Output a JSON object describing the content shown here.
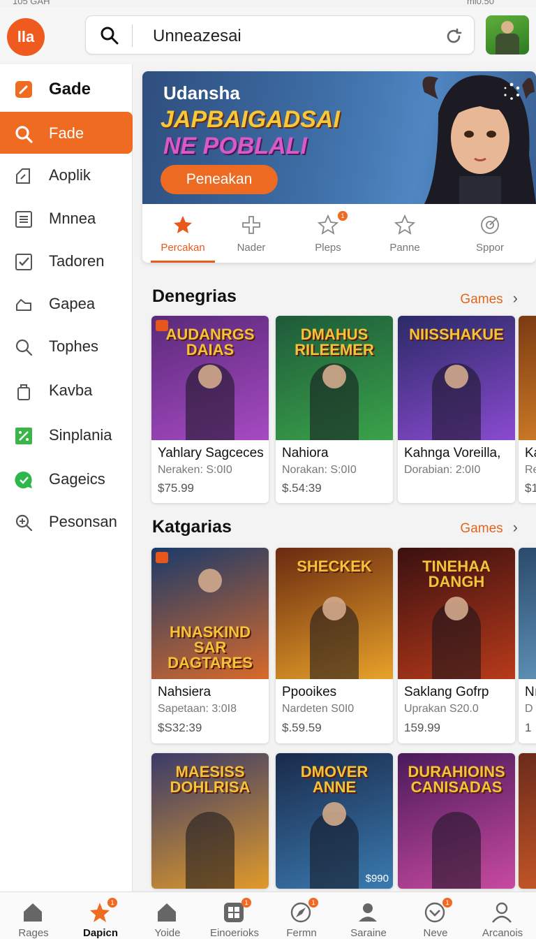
{
  "status_bar": {
    "left_text": "105 GAH",
    "right_text": "mi0.50"
  },
  "header": {
    "logo_text": "lla",
    "search_value": "Unneazesai"
  },
  "sidebar": {
    "items": [
      {
        "label": "Gade",
        "icon": "edit-square-icon"
      },
      {
        "label": "Fade",
        "icon": "search-icon"
      },
      {
        "label": "Aoplik",
        "icon": "tag-icon"
      },
      {
        "label": "Mnnea",
        "icon": "list-icon"
      },
      {
        "label": "Tadoren",
        "icon": "checkbox-icon"
      },
      {
        "label": "Gapea",
        "icon": "cloud-icon"
      },
      {
        "label": "Tophes",
        "icon": "search-icon"
      },
      {
        "label": "Kavba",
        "icon": "bag-icon"
      },
      {
        "label": "Sinplania",
        "icon": "percent-icon"
      },
      {
        "label": "Gageics",
        "icon": "chat-bubble-icon"
      },
      {
        "label": "Pesonsan",
        "icon": "zoom-in-icon"
      }
    ]
  },
  "banner": {
    "subtitle": "Udansha",
    "title_line1": "JAPBAIGADSAI",
    "title_line2": "NE POBLALI",
    "cta_label": "Peneakan"
  },
  "tabs": [
    {
      "label": "Percakan",
      "icon": "star-icon",
      "badge": ""
    },
    {
      "label": "Nader",
      "icon": "plus-icon",
      "badge": ""
    },
    {
      "label": "Pleps",
      "icon": "star-outline-icon",
      "badge": "1"
    },
    {
      "label": "Panne",
      "icon": "star-outline-icon",
      "badge": ""
    },
    {
      "label": "Sppor",
      "icon": "target-icon",
      "badge": ""
    }
  ],
  "section1": {
    "title": "Denegrias",
    "link": "Games",
    "cards": [
      {
        "art_title": "AUDANRGS DAIAS",
        "name": "Yahlary Sagceces",
        "meta": "Neraken: S:0I0",
        "price": "$75.99",
        "colors": [
          "#5a2a7a",
          "#a64ac2"
        ]
      },
      {
        "art_title": "DMAHUS RILEEMER",
        "name": "Nahiora",
        "meta": "Norakan: S:0I0",
        "price": "$.54:39",
        "colors": [
          "#1e5a3a",
          "#3aa34a"
        ]
      },
      {
        "art_title": "NIISSHAKUE",
        "name": "Kahnga Voreilla,",
        "meta": "Dorabian: 2:0I0",
        "price": "",
        "colors": [
          "#2a2a66",
          "#8a4ad0"
        ]
      },
      {
        "art_title": "",
        "name": "Ka",
        "meta": "Re",
        "price": "$1",
        "colors": [
          "#7a3a12",
          "#e08a2a"
        ]
      }
    ]
  },
  "section2": {
    "title": "Katgarias",
    "link": "Games",
    "cards": [
      {
        "art_title": "HNASKIND SAR DAGTARES",
        "name": "Nahsiera",
        "meta": "Sapetaan: 3:0I8",
        "price": "$S32:39",
        "colors": [
          "#1a3a6a",
          "#d86a2a"
        ]
      },
      {
        "art_title": "SHECKEK",
        "name": "Ppooikes",
        "meta": "Nardeten S0I0",
        "price": "$.59.59",
        "colors": [
          "#6a2a10",
          "#e8a22a"
        ]
      },
      {
        "art_title": "TINEHAA DANGH",
        "name": "Saklang Gofrp",
        "meta": "Uprakan S20.0",
        "price": "159.99",
        "colors": [
          "#3a1010",
          "#b83a1a"
        ]
      },
      {
        "art_title": "",
        "name": "Nı",
        "meta": "D",
        "price": "1",
        "colors": [
          "#2a4a6a",
          "#6aa0c8"
        ]
      }
    ]
  },
  "section3": {
    "cards": [
      {
        "art_title": "MAESISS DOHLRISA",
        "colors": [
          "#3a3a6a",
          "#e09a2a"
        ]
      },
      {
        "art_title": "DMOVER ANNE",
        "badge": "$990",
        "colors": [
          "#1a2a4a",
          "#3a7ab0"
        ]
      },
      {
        "art_title": "DURAHIOINS CANISADAS",
        "colors": [
          "#4a1a5a",
          "#c84aa0"
        ]
      },
      {
        "art_title": "",
        "colors": [
          "#6a2a1a",
          "#d8602a"
        ]
      }
    ]
  },
  "bottom_nav": [
    {
      "label": "Rages",
      "icon": "home-icon",
      "badge": ""
    },
    {
      "label": "Dapicn",
      "icon": "star-icon",
      "badge": "1"
    },
    {
      "label": "Yoide",
      "icon": "home-icon",
      "badge": ""
    },
    {
      "label": "Einoerioks",
      "icon": "grid-icon",
      "badge": "1"
    },
    {
      "label": "Fermn",
      "icon": "compass-icon",
      "badge": "1"
    },
    {
      "label": "Saraine",
      "icon": "user-icon",
      "badge": ""
    },
    {
      "label": "Neve",
      "icon": "chevron-down-circle-icon",
      "badge": "1"
    },
    {
      "label": "Arcanois",
      "icon": "person-icon",
      "badge": ""
    }
  ],
  "colors": {
    "accent": "#ef6b21",
    "sidebar_active_text": "#ffffff"
  }
}
